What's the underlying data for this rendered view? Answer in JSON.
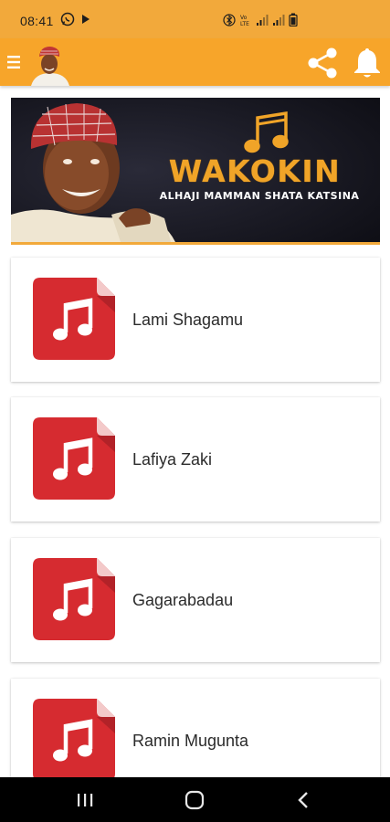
{
  "status_bar": {
    "time": "08:41",
    "icons": [
      "whatsapp-icon",
      "play-icon",
      "bluetooth-icon",
      "volte-icon",
      "signal-icon",
      "signal-icon",
      "battery-icon"
    ]
  },
  "app_bar": {
    "color": "#f7a52a",
    "icons": [
      "menu-icon",
      "avatar",
      "share-icon",
      "bell-icon"
    ]
  },
  "banner": {
    "title": "WAKOKIN",
    "subtitle": "ALHAJI MAMMAN SHATA KATSINA",
    "icon": "music-notes-icon"
  },
  "songs": [
    {
      "title": "Lami Shagamu",
      "icon": "audio-file-icon"
    },
    {
      "title": "Lafiya Zaki",
      "icon": "audio-file-icon"
    },
    {
      "title": "Gagarabadau",
      "icon": "audio-file-icon"
    },
    {
      "title": "Ramin Mugunta",
      "icon": "audio-file-icon"
    }
  ],
  "nav_bar": {
    "buttons": [
      "recents-icon",
      "home-icon",
      "back-icon"
    ]
  }
}
